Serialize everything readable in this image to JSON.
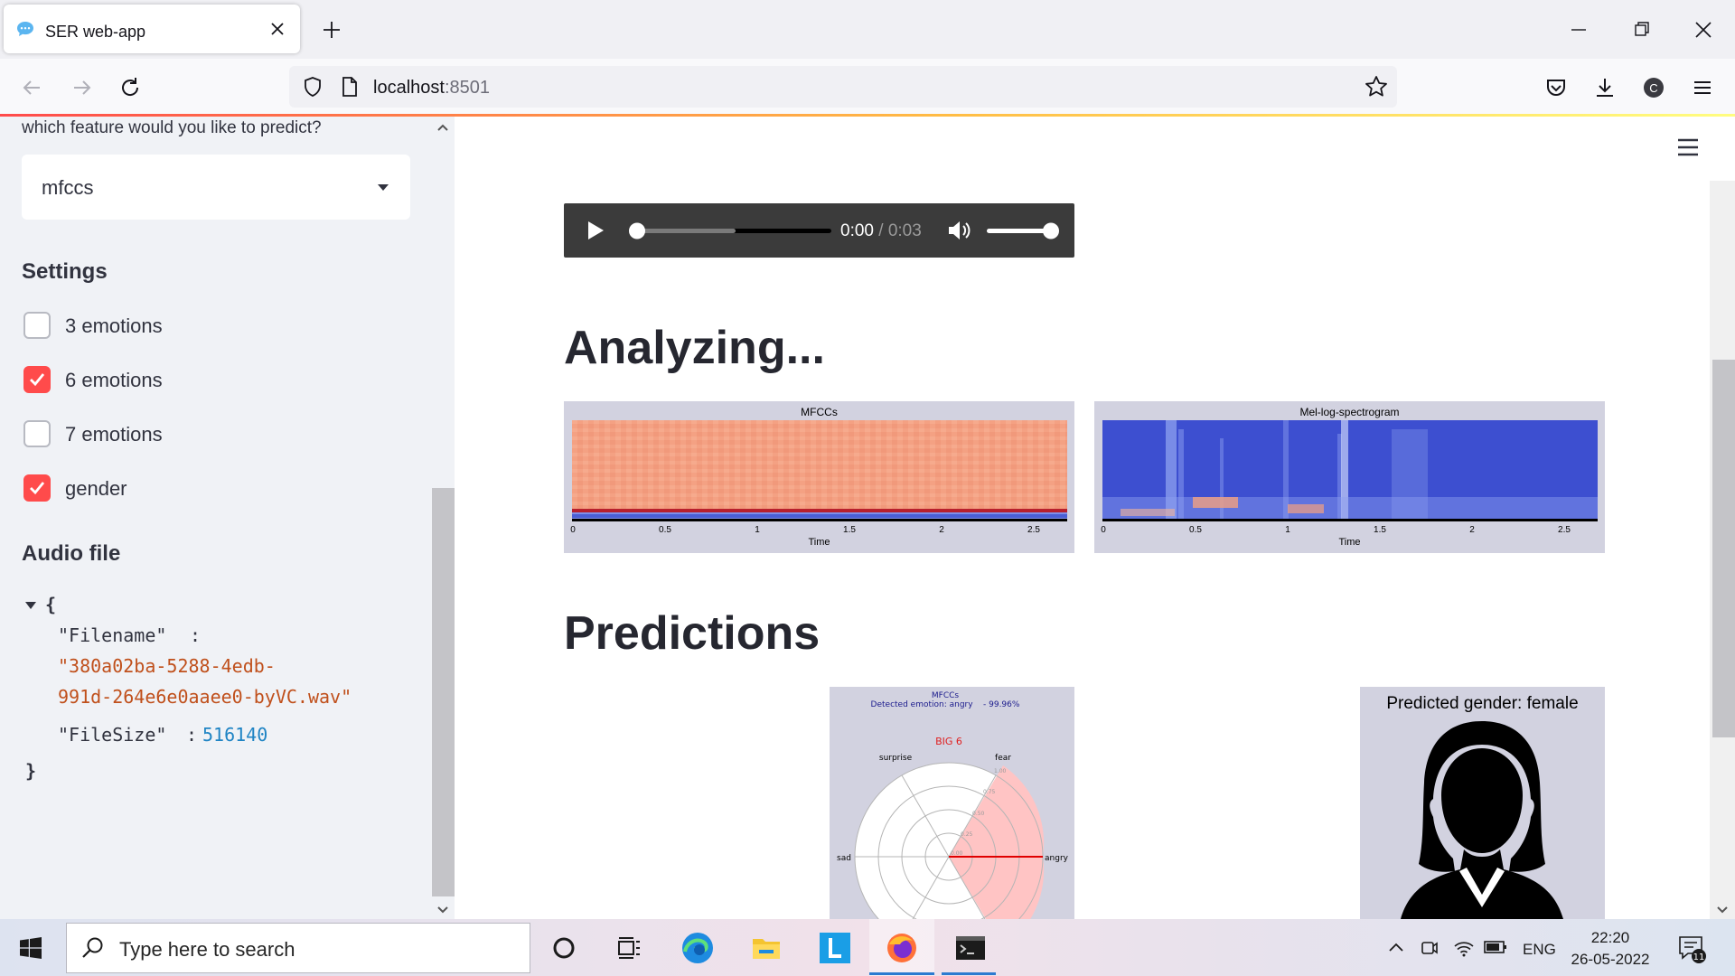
{
  "browser": {
    "tab_title": "SER web-app",
    "url_host": "localhost",
    "url_port": ":8501"
  },
  "sidebar": {
    "feature_label": "which feature would you like to predict?",
    "feature_value": "mfccs",
    "settings_heading": "Settings",
    "checkboxes": [
      {
        "label": "3 emotions",
        "checked": false
      },
      {
        "label": "6 emotions",
        "checked": true
      },
      {
        "label": "7 emotions",
        "checked": false
      },
      {
        "label": "gender",
        "checked": true
      }
    ],
    "audio_heading": "Audio file",
    "json_view": {
      "open_brace": "{",
      "close_brace": "}",
      "filename_key": "\"Filename\"",
      "filename_value_line1": "\"380a02ba-5288-4edb-",
      "filename_value_line2": "991d-264e6e0aaee0-byVC.wav\"",
      "filesize_key": "\"FileSize\"",
      "filesize_value": "516140",
      "colon": ":"
    }
  },
  "main": {
    "audio_player": {
      "current_time": "0:00",
      "separator": " / ",
      "duration": "0:03",
      "progress": 0,
      "volume": 1
    },
    "analyzing_heading": "Analyzing...",
    "predictions_heading": "Predictions",
    "mfcc_plot": {
      "title": "MFCCs",
      "xlabel": "Time",
      "ticks": [
        "0",
        "0.5",
        "1",
        "1.5",
        "2",
        "2.5"
      ]
    },
    "mel_plot": {
      "title": "Mel-log-spectrogram",
      "xlabel": "Time",
      "ticks": [
        "0",
        "0.5",
        "1",
        "1.5",
        "2",
        "2.5"
      ]
    },
    "radar": {
      "title": "MFCCs",
      "subtitle": "Detected emotion: angry    - 99.96%",
      "group": "BIG 6",
      "labels": [
        "surprise",
        "fear",
        "sad",
        "angry"
      ],
      "ring_labels": [
        "0.00",
        "0.25",
        "0.50",
        "0.75",
        "1.00"
      ]
    },
    "gender": {
      "title": "Predicted gender: female"
    }
  },
  "taskbar": {
    "search_placeholder": "Type here to search",
    "language": "ENG",
    "time": "22:20",
    "date": "26-05-2022",
    "notification_count": "11"
  },
  "colors": {
    "accent": "#ff4b4b",
    "sidebar_bg": "#f0f2f6",
    "plot_bg": "#d2d2e0",
    "mfcc_fill": "#f4a183",
    "mel_fill": "#3d4fd0",
    "json_string": "#c0501c",
    "json_number": "#1f84c4"
  }
}
